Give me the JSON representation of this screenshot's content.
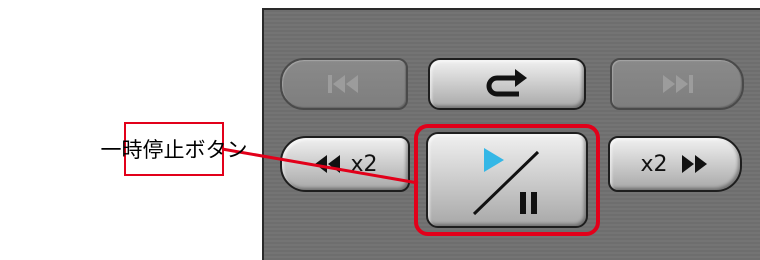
{
  "callout": {
    "text": "一時停止ボタン"
  },
  "player_panel": {
    "buttons": [
      {
        "id": "prev",
        "icon": "skip-back-icon",
        "enabled": false
      },
      {
        "id": "repeat",
        "icon": "repeat-icon",
        "enabled": true
      },
      {
        "id": "next",
        "icon": "skip-forward-icon",
        "enabled": false
      },
      {
        "id": "rewind",
        "icon": "rewind-icon",
        "speed_label": "x2",
        "enabled": true
      },
      {
        "id": "play_pause",
        "icon": "play-pause-icon",
        "enabled": true,
        "highlighted": true
      },
      {
        "id": "fast_forward",
        "icon": "fast-forward-icon",
        "speed_label": "x2",
        "enabled": true
      }
    ]
  },
  "colors": {
    "highlight": "#e2001a",
    "play_triangle": "#34b7e6",
    "panel": "#707070",
    "disabled_icon": "#9c9c9c"
  }
}
